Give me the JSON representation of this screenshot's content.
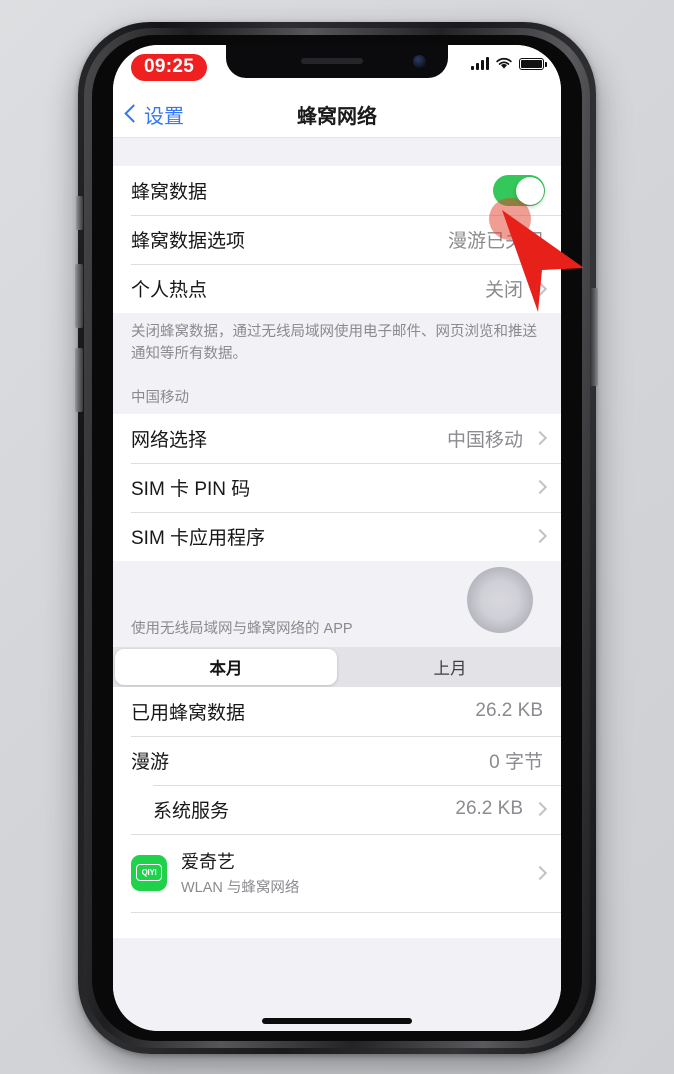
{
  "status_bar": {
    "time": "09:25",
    "signal_icon": "cellular-bars-icon",
    "wifi_icon": "wifi-icon",
    "battery_icon": "battery-full-icon"
  },
  "nav": {
    "back_label": "设置",
    "back_icon": "chevron-left-icon",
    "title": "蜂窝网络"
  },
  "sections": {
    "cellular": {
      "rows": [
        {
          "label": "蜂窝数据",
          "control": "toggle",
          "toggle_on": true
        },
        {
          "label": "蜂窝数据选项",
          "value": "漫游已关闭"
        },
        {
          "label": "个人热点",
          "value": "关闭",
          "chevron": true
        }
      ],
      "footer": "关闭蜂窝数据，通过无线局域网使用电子邮件、网页浏览和推送通知等所有数据。"
    },
    "carrier": {
      "header": "中国移动",
      "rows": [
        {
          "label": "网络选择",
          "value": "中国移动",
          "chevron": true
        },
        {
          "label": "SIM 卡 PIN 码",
          "value": "",
          "chevron": true
        },
        {
          "label": "SIM 卡应用程序",
          "value": "",
          "chevron": true
        }
      ]
    },
    "apps": {
      "header": "使用无线局域网与蜂窝网络的 APP",
      "segmented": {
        "options": [
          "本月",
          "上月"
        ],
        "selected": "本月"
      },
      "usage_rows": [
        {
          "label": "已用蜂窝数据",
          "value": "26.2 KB"
        },
        {
          "label": "漫游",
          "value": "0 字节"
        },
        {
          "label": "系统服务",
          "value": "26.2 KB",
          "chevron": true,
          "indent": true
        }
      ],
      "app_list": [
        {
          "name": "爱奇艺",
          "subtitle": "WLAN 与蜂窝网络",
          "icon_text": "QIYI",
          "icon_color": "#20d14a"
        }
      ]
    }
  },
  "overlay": {
    "cursor": "red-arrow-cursor",
    "tap_highlight": "tap-highlight-circle",
    "scroll_hint": "gray-touch-indicator"
  },
  "colors": {
    "accent_blue": "#3478f6",
    "toggle_green": "#34c759",
    "time_pill_red": "#f02020",
    "cursor_red": "#e8201a",
    "group_bg": "#ffffff",
    "page_bg": "#f1f1f6"
  }
}
